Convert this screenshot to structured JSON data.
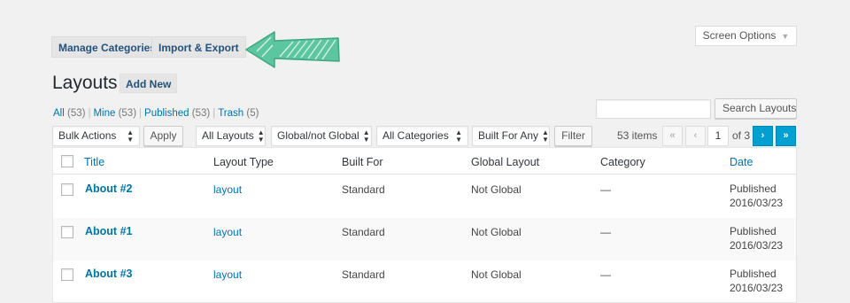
{
  "tabs": [
    {
      "label": "Manage Categories"
    },
    {
      "label": "Import & Export"
    }
  ],
  "screen_options": {
    "label": "Screen Options"
  },
  "page": {
    "title": "Layouts",
    "add_new": "Add New"
  },
  "filters_links": [
    {
      "label": "All",
      "count": "(53)"
    },
    {
      "label": "Mine",
      "count": "(53)"
    },
    {
      "label": "Published",
      "count": "(53)"
    },
    {
      "label": "Trash",
      "count": "(5)"
    }
  ],
  "search": {
    "button": "Search Layouts",
    "value": ""
  },
  "toolbar": {
    "bulk_actions": "Bulk Actions",
    "apply": "Apply",
    "all_layouts": "All Layouts",
    "global": "Global/not Global",
    "categories": "All Categories",
    "built_for": "Built For Any",
    "filter": "Filter"
  },
  "pagination": {
    "items": "53 items",
    "first": "«",
    "prev": "‹",
    "current": "1",
    "of": "of 3",
    "next": "›",
    "last": "»"
  },
  "table": {
    "columns": [
      "Title",
      "Layout Type",
      "Built For",
      "Global Layout",
      "Category",
      "Date"
    ],
    "rows": [
      {
        "title": "About #2",
        "type": "layout",
        "built_for": "Standard",
        "global": "Not Global",
        "category": "—",
        "status": "Published",
        "date": "2016/03/23"
      },
      {
        "title": "About #1",
        "type": "layout",
        "built_for": "Standard",
        "global": "Not Global",
        "category": "—",
        "status": "Published",
        "date": "2016/03/23"
      },
      {
        "title": "About #3",
        "type": "layout",
        "built_for": "Standard",
        "global": "Not Global",
        "category": "—",
        "status": "Published",
        "date": "2016/03/23"
      }
    ]
  },
  "colors": {
    "link": "#0073aa",
    "arrow": "#5cc6a0",
    "active_page": "#00a0d2"
  }
}
